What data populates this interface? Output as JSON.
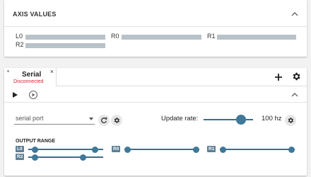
{
  "axis_values": {
    "title": "AXIS VALUES",
    "axes": [
      {
        "label": "L0",
        "level": 0.0
      },
      {
        "label": "R0",
        "level": 0.0
      },
      {
        "label": "R1",
        "level": 0.0
      },
      {
        "label": "R2",
        "level": 0.0
      }
    ]
  },
  "serial": {
    "tab_name": "Serial",
    "tab_status": "Disconnected",
    "tab_close": "×",
    "add_icon": "plus-icon",
    "settings_icon": "gear-icon",
    "play_icon": "play-icon",
    "step_icon": "play-circle-icon",
    "port_select": {
      "value": "serial port"
    },
    "update_rate": {
      "label": "Update rate:",
      "value": "100 hz",
      "slider_fraction": 0.83
    },
    "output_range": {
      "title": "OUTPUT RANGE",
      "channels": [
        {
          "label": "L0",
          "min_fraction": 0.05,
          "max_fraction": 0.93
        },
        {
          "label": "R0",
          "min_fraction": 0.0,
          "max_fraction": 1.0
        },
        {
          "label": "R1",
          "min_fraction": 0.0,
          "max_fraction": 1.0
        },
        {
          "label": "R2",
          "min_fraction": 0.05,
          "max_fraction": 0.75
        }
      ]
    }
  },
  "colors": {
    "accent": "#3f7898",
    "status_error": "#d23",
    "bar": "#b8c2c9"
  }
}
